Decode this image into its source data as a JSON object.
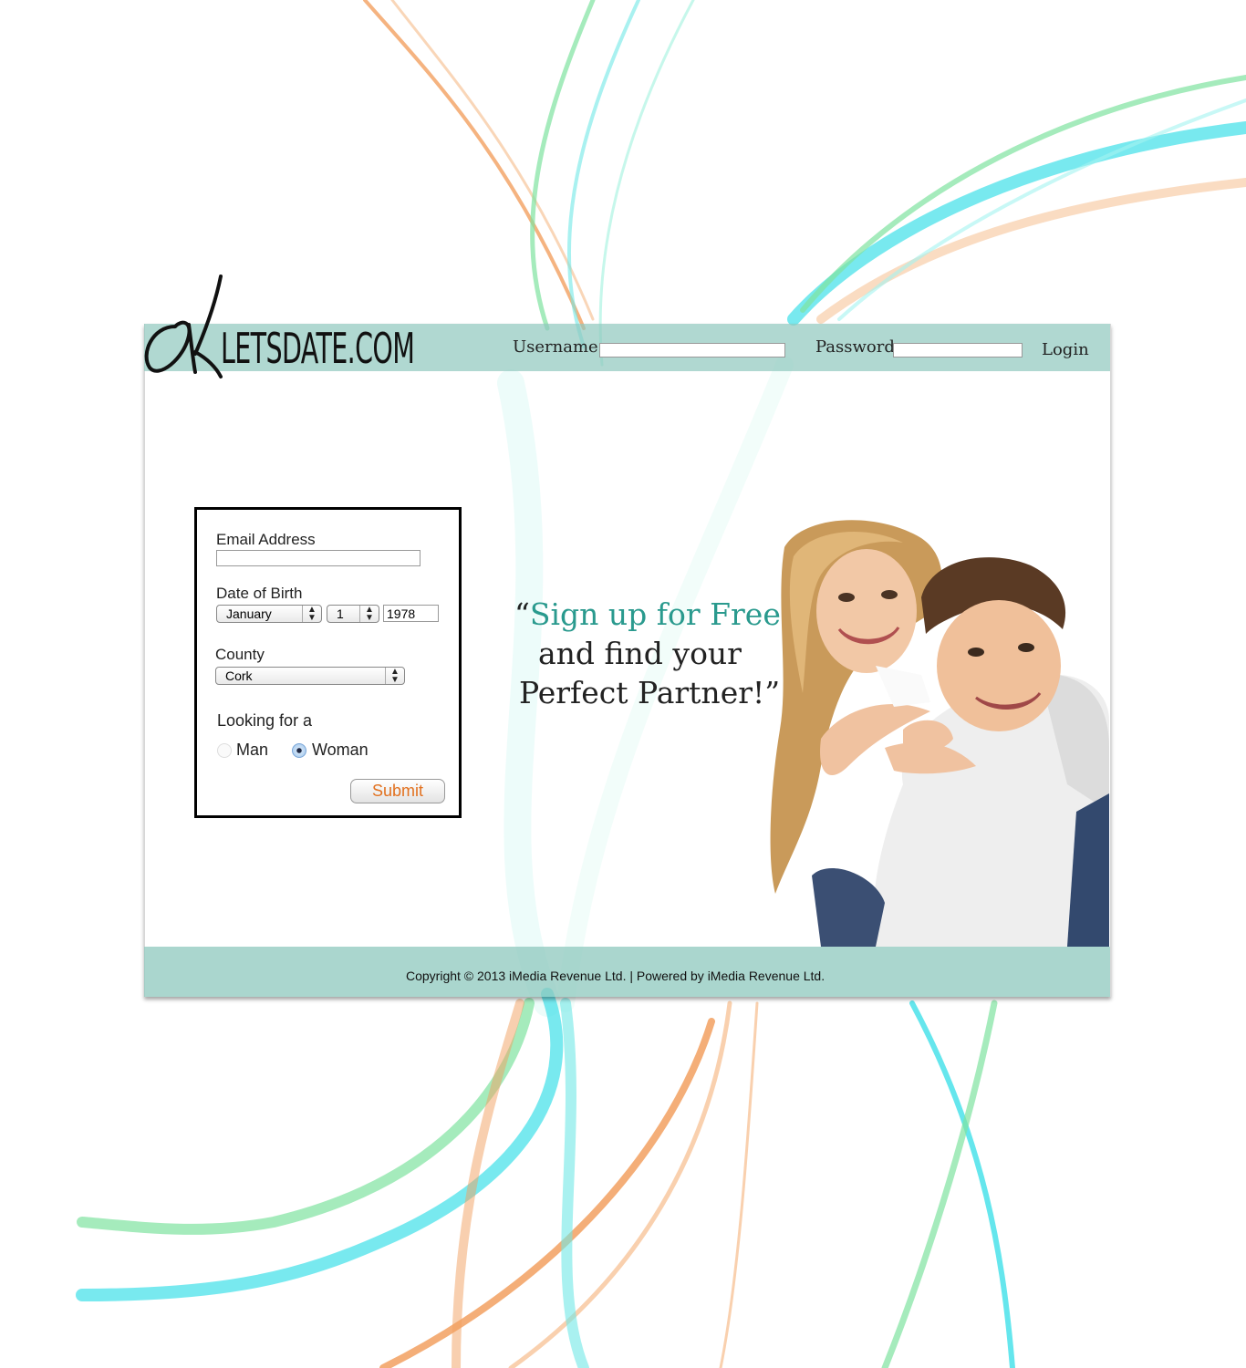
{
  "header": {
    "logo_text": "LETSDATE.COM",
    "username_label": "Username",
    "username_value": "",
    "password_label": "Password",
    "password_value": "",
    "login_label": "Login"
  },
  "signup_form": {
    "email_label": "Email Address",
    "email_value": "",
    "dob_label": "Date of Birth",
    "dob_month": "January",
    "dob_day": "1",
    "dob_year": "1978",
    "county_label": "County",
    "county_value": "Cork",
    "looking_label": "Looking for a",
    "options": [
      {
        "label": "Man",
        "selected": false
      },
      {
        "label": "Woman",
        "selected": true
      }
    ],
    "submit_label": "Submit"
  },
  "tagline": {
    "line1_open": "“",
    "line1": "Sign up for Free",
    "line2": "and find your",
    "line3": "Perfect Partner!”"
  },
  "footer": {
    "text": "Copyright © 2013 iMedia Revenue Ltd.  | Powered by iMedia Revenue Ltd."
  },
  "colors": {
    "header_bar": "#8ec8be",
    "accent_teal": "#2a9a8e",
    "submit_text": "#e2711f",
    "swirl_green": "#7fe3a0",
    "swirl_cyan": "#3fe0e8",
    "swirl_orange": "#f2a060"
  },
  "icons": {
    "select_arrows": "updown-chevron-icon"
  }
}
